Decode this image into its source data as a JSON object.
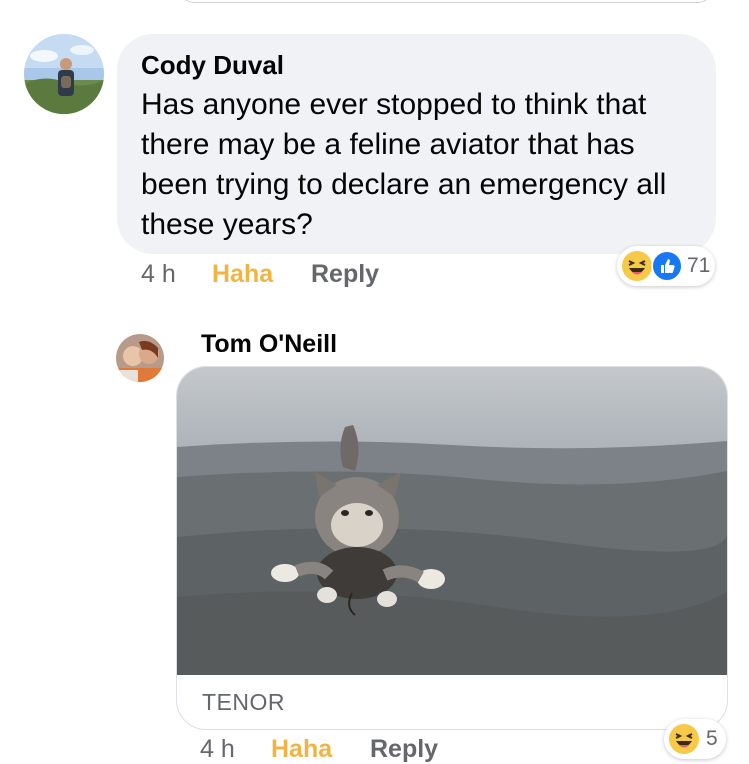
{
  "comments": [
    {
      "author": "Cody Duval",
      "text": "Has anyone ever stopped to think that there may be a feline aviator that has been trying to declare an emergency all these years?",
      "time": "4 h",
      "reaction_action": "Haha",
      "reply_label": "Reply",
      "reaction_count": "71",
      "reaction_icons": [
        "haha-emoji-icon",
        "like-thumb-icon"
      ]
    },
    {
      "author": "Tom O'Neill",
      "gif_source": "TENOR",
      "time": "4 h",
      "reaction_action": "Haha",
      "reply_label": "Reply",
      "reaction_count": "5",
      "reaction_icons": [
        "haha-emoji-icon"
      ]
    }
  ],
  "colors": {
    "bubble_bg": "#f0f2f5",
    "haha_active": "#f0b443",
    "meta_gray": "#65676b",
    "like_blue": "#1877f2"
  }
}
